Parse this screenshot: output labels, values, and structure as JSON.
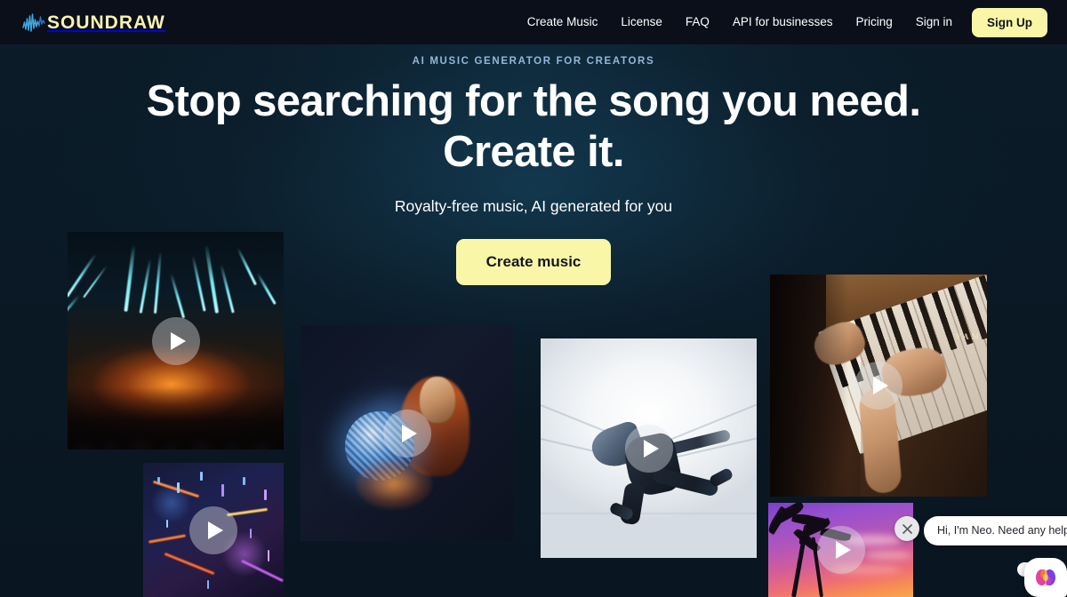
{
  "site": {
    "brand_name": "SOUNDRAW",
    "brand_color": "#faf6a8",
    "background_color": "#0a1925",
    "header_color": "#0a0f1a"
  },
  "header": {
    "logo_text": "SOUNDRAW",
    "logo_icon": "waveform-icon",
    "nav": [
      {
        "label": "Create Music"
      },
      {
        "label": "License"
      },
      {
        "label": "FAQ"
      },
      {
        "label": "API for businesses"
      },
      {
        "label": "Pricing"
      },
      {
        "label": "Sign in"
      }
    ],
    "signup_label": "Sign Up"
  },
  "hero": {
    "eyebrow": "AI MUSIC GENERATOR FOR CREATORS",
    "eyebrow_color": "#93b7d8",
    "headline_line1": "Stop searching for the song you need.",
    "headline_line2": "Create it.",
    "subheadline": "Royalty-free music, AI generated for you",
    "cta_label": "Create music",
    "cta_color": "#faf6a8"
  },
  "gallery": {
    "play_icon": "play-icon",
    "cards": [
      {
        "id": "concert",
        "alt": "Concert stage with cyan laser beams and crowd silhouette"
      },
      {
        "id": "disco",
        "alt": "Woman holding an illuminated disco ball"
      },
      {
        "id": "dancer",
        "alt": "Dancer mid-air in a bright white corridor"
      },
      {
        "id": "piano",
        "alt": "Hands playing a wooden Yamaha piano"
      },
      {
        "id": "city",
        "alt": "Aerial night city view with neon lights"
      },
      {
        "id": "sunset",
        "alt": "Tropical sunset with palm tree silhouettes"
      }
    ]
  },
  "chat": {
    "message": "Hi, I'm Neo. Need any help?",
    "close_icon": "close-icon",
    "launcher_icon": "neo-brain-icon"
  }
}
